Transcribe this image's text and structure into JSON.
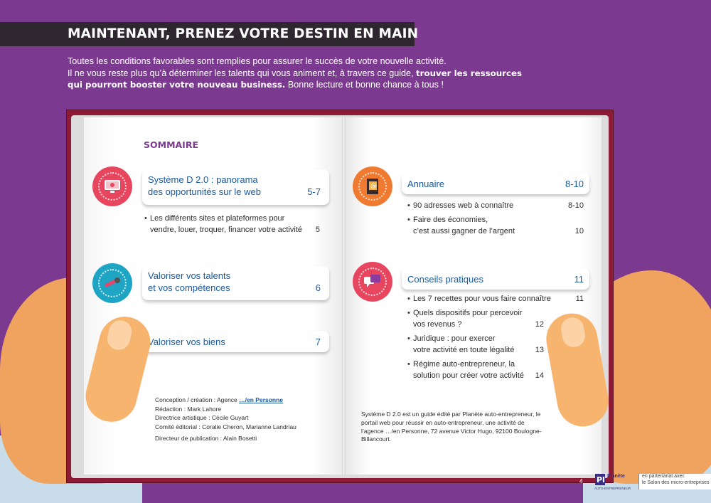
{
  "header": {
    "title": "MAINTENANT, PRENEZ VOTRE DESTIN EN MAIN",
    "intro_line1": "Toutes les conditions favorables sont remplies pour assurer le succès de votre nouvelle activité.",
    "intro_line2_prefix": "Il ne vous reste plus qu’à déterminer les talents qui vous animent et, à travers ce guide,",
    "intro_bold": "trouver les ressources qui pourront booster votre nouveau business.",
    "intro_suffix": "Bonne lecture et bonne chance à tous !"
  },
  "sommaire": {
    "title": "SOMMAIRE",
    "left": [
      {
        "title_line1": "Système D 2.0 : panorama",
        "title_line2": "des opportunités sur le web",
        "pages": "5-7",
        "items": [
          {
            "line1": "Les différents sites et plateformes pour",
            "line2": "vendre, louer, troquer, financer votre activité",
            "page": "5"
          }
        ]
      },
      {
        "title_line1": "Valoriser vos talents",
        "title_line2": "et vos compétences",
        "pages": "6"
      },
      {
        "title_line1": "Valoriser vos biens",
        "pages": "7"
      }
    ],
    "right": [
      {
        "title_line1": "Annuaire",
        "pages": "8-10",
        "items": [
          {
            "line1": "90 adresses web à connaître",
            "page": "8-10"
          },
          {
            "line1": "Faire des économies,",
            "line2": "c’est aussi gagner de l’argent",
            "page": "10"
          }
        ]
      },
      {
        "title_line1": "Conseils pratiques",
        "pages": "11",
        "items": [
          {
            "line1": "Les 7 recettes pour vous faire connaître",
            "page": "11"
          },
          {
            "line1": "Quels dispositifs pour percevoir",
            "line2": "vos revenus ?",
            "page": "12"
          },
          {
            "line1": "Juridique : pour exercer",
            "line2": "votre activité en toute légalité",
            "page": "13"
          },
          {
            "line1": "Régime auto-entrepreneur, la",
            "line2": "solution pour créer votre activité",
            "page": "14"
          }
        ]
      }
    ]
  },
  "credits": {
    "concept_prefix": "Conception / création : Agence",
    "concept_link": "…/en Personne",
    "redaction": "Rédaction : Mark Lahore",
    "direction": "Directrice artistique : Cécile Guyart",
    "comite": "Comité éditorial : Coralie Cheron, Marianne Landriau",
    "directeur": "Directeur de publication : Alain Bosetti"
  },
  "about": "Système D 2.0 est un guide édité par Planète auto-entrepreneur, le portail web pour réussir en auto-entrepreneur, une activité de l’agence …/en Personne, 72 avenue Victor Hugo, 92100 Boulogne-Billancourt.",
  "footer": {
    "page_number": "4",
    "logo_text": "Planète",
    "logo_sub": "AUTO-ENTREPRENEUR",
    "partner_line1": "en partenariat avec",
    "partner_line2": "le Salon des micro-entreprises"
  },
  "colors": {
    "background": "#7b3a8f",
    "title_bar": "#2e2730",
    "book_cover": "#8e1b36",
    "section_title": "#1a5aa0",
    "badge_pink": "#e8455e",
    "badge_cyan": "#1fa5c4",
    "badge_orange": "#f07a30"
  },
  "icons": [
    "computer-icon",
    "microphone-icon",
    "notebook-icon",
    "speech-bubble-icon"
  ]
}
